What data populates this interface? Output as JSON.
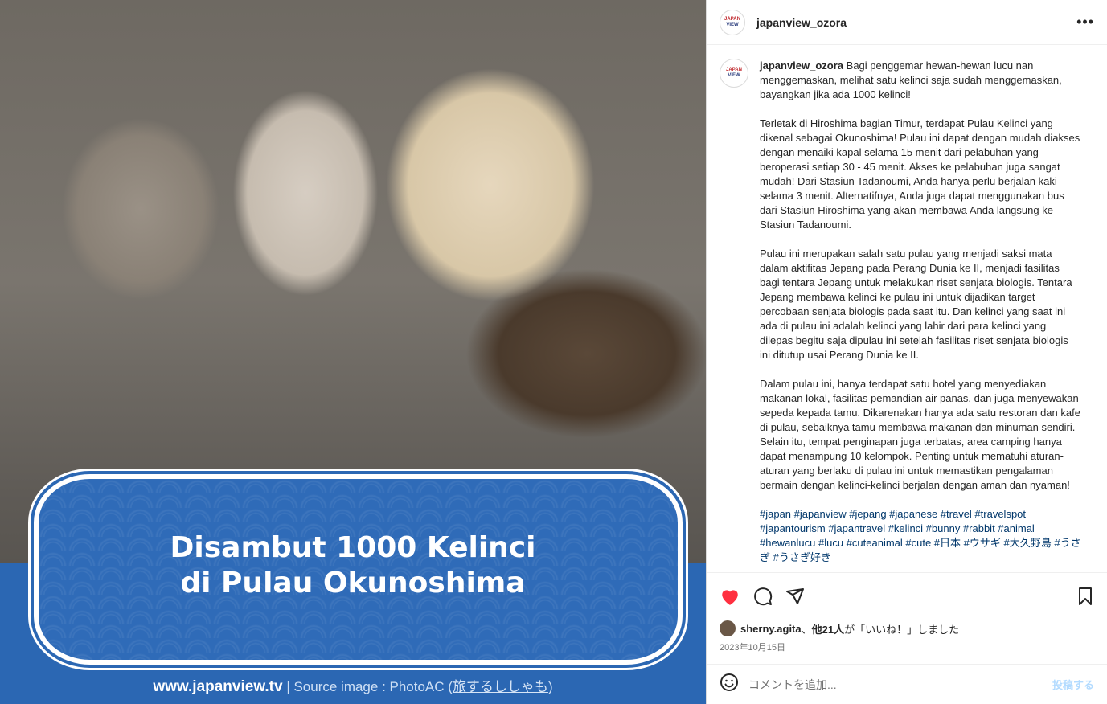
{
  "post": {
    "banner_line1": "Disambut 1000 Kelinci",
    "banner_line2": "di Pulau Okunoshima",
    "site": "www.japanview.tv",
    "source_prefix": "| Source image : PhotoAC (",
    "source_link": "旅するししゃも",
    "source_suffix": ")"
  },
  "header": {
    "username": "japanview_ozora",
    "logo_top": "JAPAN",
    "logo_bottom": "VIEW",
    "more_icon": "more-horizontal-icon"
  },
  "caption": {
    "username": "japanview_ozora",
    "p1": " Bagi penggemar hewan-hewan lucu nan menggemaskan, melihat satu kelinci saja sudah menggemaskan, bayangkan jika ada 1000 kelinci!",
    "p2": "Terletak di Hiroshima bagian Timur, terdapat Pulau Kelinci yang dikenal sebagai Okunoshima! Pulau ini dapat dengan mudah diakses dengan menaiki kapal selama 15 menit dari pelabuhan yang beroperasi setiap 30 - 45 menit. Akses ke pelabuhan juga sangat mudah! Dari Stasiun Tadanoumi, Anda hanya perlu berjalan kaki selama 3 menit. Alternatifnya, Anda juga dapat menggunakan bus dari Stasiun Hiroshima yang akan membawa Anda langsung ke Stasiun Tadanoumi.",
    "p3": "Pulau ini merupakan salah satu pulau yang menjadi saksi mata dalam aktifitas Jepang pada Perang Dunia ke II, menjadi fasilitas bagi tentara Jepang untuk melakukan riset senjata biologis. Tentara Jepang membawa kelinci ke pulau ini untuk dijadikan target percobaan senjata biologis pada saat itu. Dan kelinci yang saat ini ada di pulau ini adalah kelinci yang lahir dari para kelinci yang dilepas begitu saja dipulau ini setelah fasilitas riset senjata biologis ini ditutup usai Perang Dunia ke II.",
    "p4": "Dalam pulau ini, hanya terdapat satu hotel yang menyediakan makanan lokal, fasilitas pemandian air panas, dan juga menyewakan sepeda kepada tamu. Dikarenakan hanya ada satu restoran dan kafe di pulau, sebaiknya tamu membawa makanan dan minuman sendiri. Selain itu, tempat penginapan juga terbatas, area camping hanya dapat menampung 10 kelompok. Penting untuk mematuhi aturan-aturan yang berlaku di pulau ini untuk memastikan pengalaman bermain dengan kelinci-kelinci berjalan dengan aman dan nyaman!",
    "tags": "#japan #japanview #jepang #japanese #travel #travelspot #japantourism #japantravel #kelinci #bunny #rabbit #animal #hewanlucu #lucu #cuteanimal #cute #日本 #ウサギ #大久野島 #うさぎ #うさぎ好き"
  },
  "actions": {
    "like_color": "#ff3040"
  },
  "likes": {
    "user": "sherny.agita",
    "text_mid": "、",
    "others": "他21人",
    "text_end": "が「いいね！」しました"
  },
  "date": "2023年10月15日",
  "comment": {
    "placeholder": "コメントを追加...",
    "post_label": "投稿する"
  }
}
